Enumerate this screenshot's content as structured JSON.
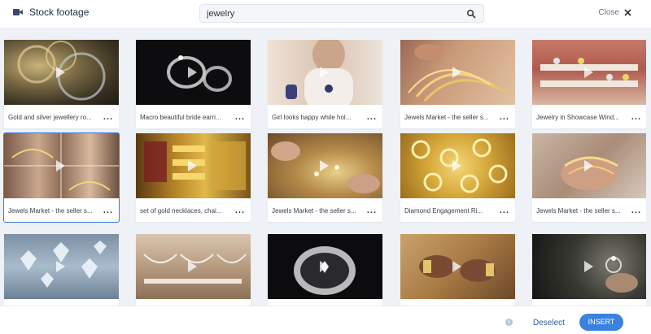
{
  "header": {
    "title": "Stock footage",
    "title_icon": "video-camera-icon",
    "search_value": "jewelry",
    "search_icon": "search-icon",
    "close_label": "Close",
    "close_icon": "close-icon"
  },
  "cards": [
    {
      "caption": "Gold and silver jewellery ro...",
      "more": "..."
    },
    {
      "caption": "Macro beautiful bride earri...",
      "more": "..."
    },
    {
      "caption": "Girl looks happy while hol...",
      "more": "..."
    },
    {
      "caption": "Jewels Market - the seller s...",
      "more": "..."
    },
    {
      "caption": "Jewelry in Showcase Wind...",
      "more": "..."
    },
    {
      "caption": "Jewels Market - the seller s...",
      "more": "...",
      "selected": true
    },
    {
      "caption": "set of gold necklaces, chai...",
      "more": "..."
    },
    {
      "caption": "Jewels Market - the seller s...",
      "more": "..."
    },
    {
      "caption": "Diamond Engagement Ri...",
      "more": "..."
    },
    {
      "caption": "Jewels Market - the seller s...",
      "more": "..."
    },
    {
      "caption": "",
      "more": ""
    },
    {
      "caption": "",
      "more": ""
    },
    {
      "caption": "",
      "more": ""
    },
    {
      "caption": "",
      "more": ""
    },
    {
      "caption": "",
      "more": ""
    }
  ],
  "footer": {
    "info_icon": "info-icon",
    "info_glyph": "i",
    "deselect_label": "Deselect",
    "insert_label": "INSERT"
  },
  "colors": {
    "accent": "#3b82e0",
    "selection": "#3a7bd5",
    "link": "#2f5aa8"
  }
}
